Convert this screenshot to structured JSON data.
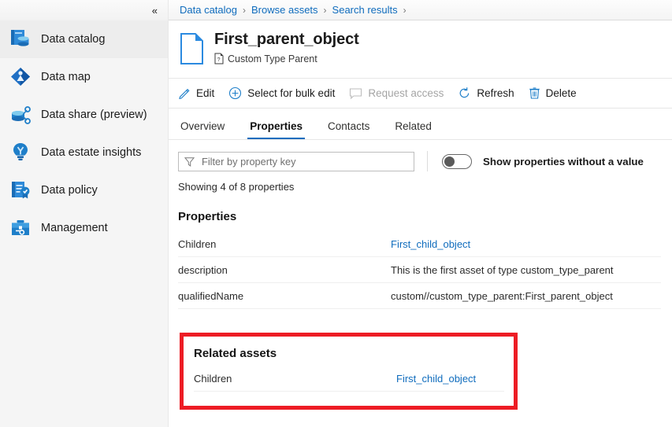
{
  "sidebar": {
    "collapse_label": "«",
    "items": [
      {
        "label": "Data catalog",
        "icon": "data-catalog-icon",
        "selected": true
      },
      {
        "label": "Data map",
        "icon": "data-map-icon",
        "selected": false
      },
      {
        "label": "Data share (preview)",
        "icon": "data-share-icon",
        "selected": false
      },
      {
        "label": "Data estate insights",
        "icon": "data-estate-insights-icon",
        "selected": false
      },
      {
        "label": "Data policy",
        "icon": "data-policy-icon",
        "selected": false
      },
      {
        "label": "Management",
        "icon": "management-icon",
        "selected": false
      }
    ]
  },
  "breadcrumb": {
    "items": [
      "Data catalog",
      "Browse assets",
      "Search results"
    ],
    "separator": "›",
    "trailing_separator": "›"
  },
  "header": {
    "title": "First_parent_object",
    "subtitle": "Custom Type Parent",
    "icon": "document-icon",
    "subtitle_icon": "custom-type-icon"
  },
  "toolbar": {
    "items": [
      {
        "label": "Edit",
        "icon": "pencil-icon",
        "disabled": false
      },
      {
        "label": "Select for bulk edit",
        "icon": "plus-circle-icon",
        "disabled": false
      },
      {
        "label": "Request access",
        "icon": "comment-icon",
        "disabled": true
      },
      {
        "label": "Refresh",
        "icon": "refresh-icon",
        "disabled": false
      },
      {
        "label": "Delete",
        "icon": "trash-icon",
        "disabled": false
      }
    ]
  },
  "tabs": [
    {
      "label": "Overview",
      "active": false
    },
    {
      "label": "Properties",
      "active": true
    },
    {
      "label": "Contacts",
      "active": false
    },
    {
      "label": "Related",
      "active": false
    }
  ],
  "filter": {
    "placeholder": "Filter by property key",
    "value": "",
    "icon": "filter-funnel-icon"
  },
  "toggle": {
    "label": "Show properties without a value",
    "state": "off"
  },
  "showing_text": "Showing 4 of 8 properties",
  "properties_section": {
    "title": "Properties",
    "rows": [
      {
        "key": "Children",
        "value": "First_child_object",
        "is_link": true
      },
      {
        "key": "description",
        "value": "This is the first asset of type custom_type_parent",
        "is_link": false
      },
      {
        "key": "qualifiedName",
        "value": "custom//custom_type_parent:First_parent_object",
        "is_link": false
      }
    ]
  },
  "related_assets_section": {
    "title": "Related assets",
    "highlight_color": "#ed1c24",
    "rows": [
      {
        "key": "Children",
        "value": "First_child_object",
        "is_link": true
      }
    ]
  },
  "colors": {
    "accent": "#0f6cbd",
    "link": "#0f6cbd",
    "highlight": "#ed1c24",
    "sidebar_bg": "#f5f5f5",
    "selected_bg": "#ededed"
  }
}
